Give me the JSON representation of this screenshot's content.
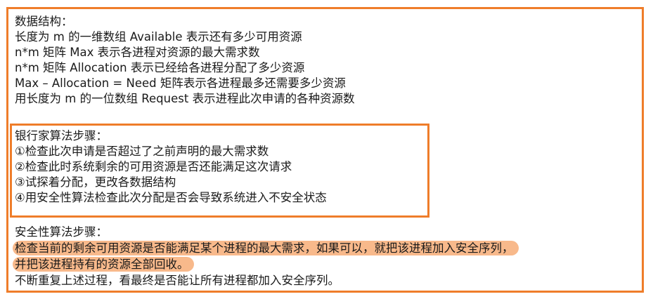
{
  "data_structures": {
    "heading": "数据结构：",
    "lines": [
      "长度为 m 的一维数组 Available 表示还有多少可用资源",
      "n*m 矩阵 Max 表示各进程对资源的最大需求数",
      "n*m 矩阵 Allocation 表示已经给各进程分配了多少资源",
      "Max – Allocation = Need 矩阵表示各进程最多还需要多少资源",
      "用长度为 m 的一位数组 Request 表示进程此次申请的各种资源数"
    ]
  },
  "bankers_steps": {
    "heading": "银行家算法步骤：",
    "steps": [
      "①检查此次申请是否超过了之前声明的最大需求数",
      "②检查此时系统剩余的可用资源是否还能满足这次请求",
      "③试探着分配，更改各数据结构",
      "④用安全性算法检查此次分配是否会导致系统进入不安全状态"
    ]
  },
  "safety_steps": {
    "heading": "安全性算法步骤：",
    "highlighted_lines": [
      "检查当前的剩余可用资源是否能满足某个进程的最大需求，如果可以，就把该进程加入安全序列，",
      "并把该进程持有的资源全部回收。"
    ],
    "last_line": "不断重复上述过程，看最终是否能让所有进程都加入安全序列。"
  },
  "colors": {
    "frame_border": "#ef7d2a",
    "highlight": "#f8b98b",
    "text": "#1a1a1a"
  }
}
